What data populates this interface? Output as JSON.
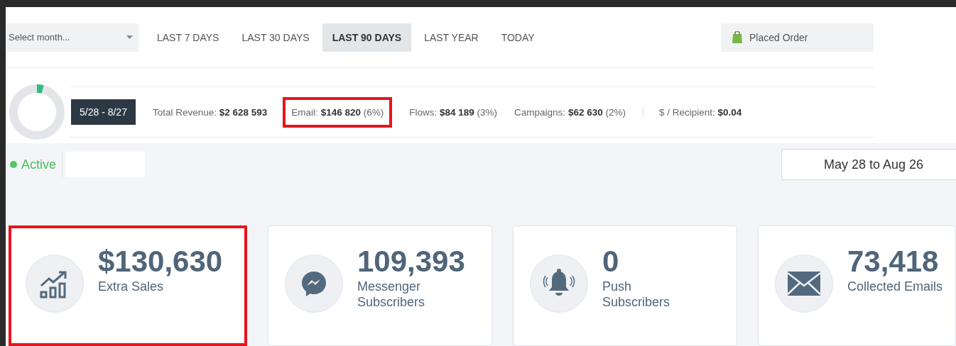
{
  "filter_bar": {
    "month_select": {
      "placeholder": "Select month..."
    },
    "tabs": [
      {
        "label": "LAST 7 DAYS",
        "selected": false
      },
      {
        "label": "LAST 30 DAYS",
        "selected": false
      },
      {
        "label": "LAST 90 DAYS",
        "selected": true
      },
      {
        "label": "LAST YEAR",
        "selected": false
      },
      {
        "label": "TODAY",
        "selected": false
      }
    ],
    "event_select": {
      "value": "Placed Order"
    }
  },
  "summary": {
    "progress": {
      "level": 0.04
    },
    "date_badge": "5/28 - 8/27",
    "stats": [
      {
        "label": "Total Revenue:",
        "value": "$2 628 593",
        "highlighted": false,
        "separated": false
      },
      {
        "label": "Email:",
        "value": "$146 820",
        "share": "(6%)",
        "highlighted": true,
        "separated": false
      },
      {
        "label": "Flows:",
        "value": "$84 189",
        "share": "(3%)",
        "highlighted": false,
        "separated": false
      },
      {
        "label": "Campaigns:",
        "value": "$62 630",
        "share": "(2%)",
        "highlighted": false,
        "separated": false
      },
      {
        "label": "$ / Recipient:",
        "value": "$0.04",
        "highlighted": false,
        "separated": true
      }
    ]
  },
  "status": {
    "label": "Active"
  },
  "date_range": "May 28 to Aug 26",
  "cards": [
    {
      "kind": "sales",
      "value": "$130,630",
      "label": "Extra Sales",
      "highlighted": true
    },
    {
      "kind": "messenger",
      "value": "109,393",
      "label": "Messenger Subscribers",
      "highlighted": false
    },
    {
      "kind": "push",
      "value": "0",
      "label": "Push Subscribers",
      "highlighted": false
    },
    {
      "kind": "email",
      "value": "73,418",
      "label": "Collected Emails",
      "highlighted": false
    }
  ]
}
